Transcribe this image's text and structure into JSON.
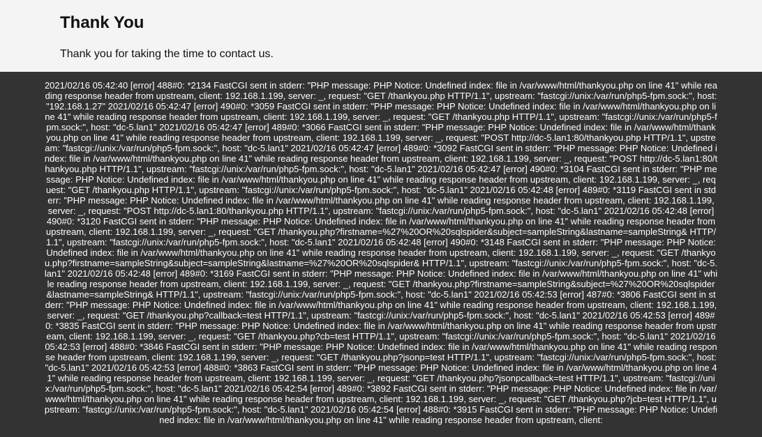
{
  "page": {
    "title": "Thank You",
    "message": "Thank you for taking the time to contact us."
  },
  "log": {
    "text": "2021/02/16 05:42:40 [error] 488#0: *2134 FastCGI sent in stderr: \"PHP message: PHP Notice: Undefined index: file in /var/www/html/thankyou.php on line 41\" while reading response header from upstream, client: 192.168.1.199, server: _, request: \"GET /thankyou.php HTTP/1.1\", upstream: \"fastcgi://unix:/var/run/php5-fpm.sock:\", host: \"192.168.1.27\" 2021/02/16 05:42:47 [error] 490#0: *3059 FastCGI sent in stderr: \"PHP message: PHP Notice: Undefined index: file in /var/www/html/thankyou.php on line 41\" while reading response header from upstream, client: 192.168.1.199, server: _, request: \"GET /thankyou.php HTTP/1.1\", upstream: \"fastcgi://unix:/var/run/php5-fpm.sock:\", host: \"dc-5.lan1\" 2021/02/16 05:42:47 [error] 489#0: *3066 FastCGI sent in stderr: \"PHP message: PHP Notice: Undefined index: file in /var/www/html/thankyou.php on line 41\" while reading response header from upstream, client: 192.168.1.199, server: _, request: \"POST http://dc-5.lan1:80/thankyou.php HTTP/1.1\", upstream: \"fastcgi://unix:/var/run/php5-fpm.sock:\", host: \"dc-5.lan1\" 2021/02/16 05:42:47 [error] 489#0: *3092 FastCGI sent in stderr: \"PHP message: PHP Notice: Undefined index: file in /var/www/html/thankyou.php on line 41\" while reading response header from upstream, client: 192.168.1.199, server: _, request: \"POST http://dc-5.lan1:80/thankyou.php HTTP/1.1\", upstream: \"fastcgi://unix:/var/run/php5-fpm.sock:\", host: \"dc-5.lan1\" 2021/02/16 05:42:47 [error] 490#0: *3104 FastCGI sent in stderr: \"PHP message: PHP Notice: Undefined index: file in /var/www/html/thankyou.php on line 41\" while reading response header from upstream, client: 192.168.1.199, server: _, request: \"GET /thankyou.php HTTP/1.1\", upstream: \"fastcgi://unix:/var/run/php5-fpm.sock:\", host: \"dc-5.lan1\" 2021/02/16 05:42:48 [error] 489#0: *3119 FastCGI sent in stderr: \"PHP message: PHP Notice: Undefined index: file in /var/www/html/thankyou.php on line 41\" while reading response header from upstream, client: 192.168.1.199, server: _, request: \"POST http://dc-5.lan1:80/thankyou.php HTTP/1.1\", upstream: \"fastcgi://unix:/var/run/php5-fpm.sock:\", host: \"dc-5.lan1\" 2021/02/16 05:42:48 [error] 490#0: *3120 FastCGI sent in stderr: \"PHP message: PHP Notice: Undefined index: file in /var/www/html/thankyou.php on line 41\" while reading response header from upstream, client: 192.168.1.199, server: _, request: \"GET /thankyou.php?firstname=%27%20OR%20sqlspider&subject=sampleString&lastname=sampleString& HTTP/1.1\", upstream: \"fastcgi://unix:/var/run/php5-fpm.sock:\", host: \"dc-5.lan1\" 2021/02/16 05:42:48 [error] 490#0: *3148 FastCGI sent in stderr: \"PHP message: PHP Notice: Undefined index: file in /var/www/html/thankyou.php on line 41\" while reading response header from upstream, client: 192.168.1.199, server: _, request: \"GET /thankyou.php?firstname=sampleString&subject=sampleString&lastname=%27%20OR%20sqlspider& HTTP/1.1\", upstream: \"fastcgi://unix:/var/run/php5-fpm.sock:\", host: \"dc-5.lan1\" 2021/02/16 05:42:48 [error] 489#0: *3169 FastCGI sent in stderr: \"PHP message: PHP Notice: Undefined index: file in /var/www/html/thankyou.php on line 41\" while reading response header from upstream, client: 192.168.1.199, server: _, request: \"GET /thankyou.php?firstname=sampleString&subject=%27%20OR%20sqlspider&lastname=sampleString& HTTP/1.1\", upstream: \"fastcgi://unix:/var/run/php5-fpm.sock:\", host: \"dc-5.lan1\" 2021/02/16 05:42:53 [error] 487#0: *3806 FastCGI sent in stderr: \"PHP message: PHP Notice: Undefined index: file in /var/www/html/thankyou.php on line 41\" while reading response header from upstream, client: 192.168.1.199, server: _, request: \"GET /thankyou.php?callback=test HTTP/1.1\", upstream: \"fastcgi://unix:/var/run/php5-fpm.sock:\", host: \"dc-5.lan1\" 2021/02/16 05:42:53 [error] 489#0: *3835 FastCGI sent in stderr: \"PHP message: PHP Notice: Undefined index: file in /var/www/html/thankyou.php on line 41\" while reading response header from upstream, client: 192.168.1.199, server: _, request: \"GET /thankyou.php?cb=test HTTP/1.1\", upstream: \"fastcgi://unix:/var/run/php5-fpm.sock:\", host: \"dc-5.lan1\" 2021/02/16 05:42:53 [error] 488#0: *3846 FastCGI sent in stderr: \"PHP message: PHP Notice: Undefined index: file in /var/www/html/thankyou.php on line 41\" while reading response header from upstream, client: 192.168.1.199, server: _, request: \"GET /thankyou.php?jsonp=test HTTP/1.1\", upstream: \"fastcgi://unix:/var/run/php5-fpm.sock:\", host: \"dc-5.lan1\" 2021/02/16 05:42:53 [error] 488#0: *3863 FastCGI sent in stderr: \"PHP message: PHP Notice: Undefined index: file in /var/www/html/thankyou.php on line 41\" while reading response header from upstream, client: 192.168.1.199, server: _, request: \"GET /thankyou.php?jsonpcallback=test HTTP/1.1\", upstream: \"fastcgi://unix:/var/run/php5-fpm.sock:\", host: \"dc-5.lan1\" 2021/02/16 05:42:54 [error] 489#0: *3892 FastCGI sent in stderr: \"PHP message: PHP Notice: Undefined index: file in /var/www/html/thankyou.php on line 41\" while reading response header from upstream, client: 192.168.1.199, server: _, request: \"GET /thankyou.php?jcb=test HTTP/1.1\", upstream: \"fastcgi://unix:/var/run/php5-fpm.sock:\", host: \"dc-5.lan1\" 2021/02/16 05:42:54 [error] 488#0: *3915 FastCGI sent in stderr: \"PHP message: PHP Notice: Undefined index: file in /var/www/html/thankyou.php on line 41\" while reading response header from upstream, client:"
  }
}
